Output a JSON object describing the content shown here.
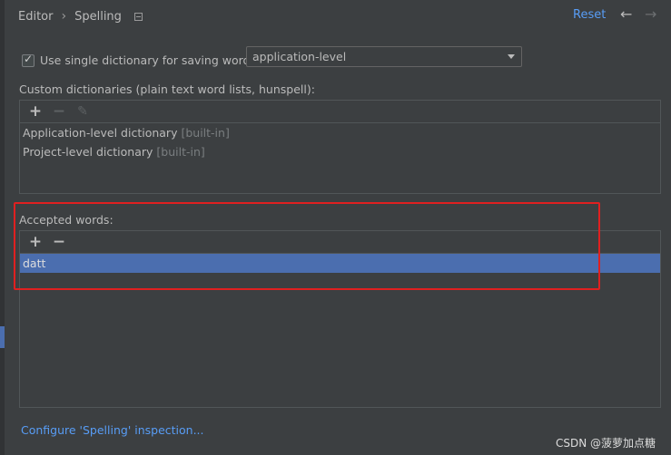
{
  "header": {
    "crumb1": "Editor",
    "separator": "›",
    "crumb2": "Spelling",
    "reset_label": "Reset",
    "back_icon": "←",
    "forward_icon": "→"
  },
  "settings": {
    "single_dictionary_checked": true,
    "single_dictionary_label": "Use single dictionary for saving words:",
    "dictionary_level_value": "application-level"
  },
  "custom_dictionaries": {
    "label": "Custom dictionaries (plain text word lists, hunspell):",
    "add_icon": "+",
    "remove_icon": "−",
    "edit_icon": "✎",
    "items": [
      {
        "name": "Application-level dictionary",
        "suffix": "[built-in]"
      },
      {
        "name": "Project-level dictionary",
        "suffix": "[built-in]"
      }
    ]
  },
  "accepted_words": {
    "label": "Accepted words:",
    "add_icon": "+",
    "remove_icon": "−",
    "items": [
      "datt"
    ]
  },
  "footer": {
    "configure_link": "Configure 'Spelling' inspection...",
    "watermark": "CSDN @菠萝加点糖"
  },
  "colors": {
    "background": "#3c3f41",
    "link": "#589df6",
    "selection": "#4b6eaf",
    "highlight_border": "#e02020"
  }
}
